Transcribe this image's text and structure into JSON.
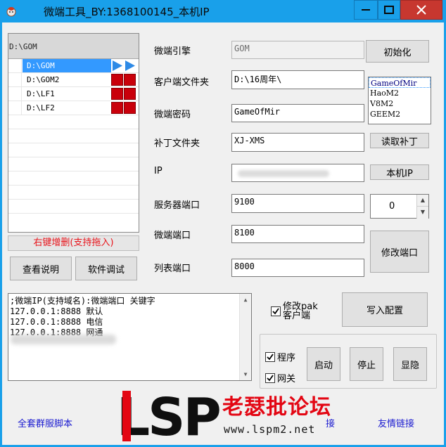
{
  "window": {
    "title": "微端工具_BY:1368100145_本机IP",
    "titlebar_color": "#19a0ea"
  },
  "dir_list": {
    "header": "D:\\GOM",
    "items": [
      {
        "path": "D:\\GOM",
        "selected": true,
        "status_icons": "blue-play-arrows"
      },
      {
        "path": "D:\\GOM2",
        "selected": false,
        "status_icons": "red-squares"
      },
      {
        "path": "D:\\LF1",
        "selected": false,
        "status_icons": "red-squares"
      },
      {
        "path": "D:\\LF2",
        "selected": false,
        "status_icons": "red-squares"
      }
    ],
    "hint": "右键增删(支持拖入)"
  },
  "buttons": {
    "help": "查看说明",
    "debug": "软件调试",
    "init": "初始化",
    "read_patch": "读取补丁",
    "local_ip": "本机IP",
    "modify_port": "修改端口",
    "write_config": "写入配置",
    "start": "启动",
    "stop": "停止",
    "show_hide": "显隐"
  },
  "form": {
    "engine_label": "微端引擎",
    "engine_value": "GOM",
    "client_dir_label": "客户端文件夹",
    "client_dir_value": "D:\\16周年\\",
    "password_label": "微端密码",
    "password_value": "GameOfMir",
    "patch_dir_label": "补丁文件夹",
    "patch_dir_value": "XJ-XMS",
    "ip_label": "IP",
    "ip_value": "",
    "server_port_label": "服务器端口",
    "server_port_value": "9100",
    "micro_port_label": "微端端口",
    "micro_port_value": "8100",
    "list_port_label": "列表端口",
    "list_port_value": "8000"
  },
  "server_types": [
    "GameOfMir",
    "HaoM2",
    "V8M2",
    "GEEM2"
  ],
  "server_type_selected": "GameOfMir",
  "spinner_value": "0",
  "config_memo": {
    "lines": [
      ";微端IP(支持域名):微端端口 关键字",
      "127.0.0.1:8888 默认",
      "127.0.0.1:8888 电信",
      "127.0.0.1:8888 网通"
    ]
  },
  "checkboxes": {
    "modify_pak_line1": "修改pak",
    "modify_pak_line2": "客户端",
    "modify_pak_checked": true,
    "program": "程序",
    "program_checked": true,
    "gateway": "网关",
    "gateway_checked": true
  },
  "footer": {
    "left_link": "全套群服脚本",
    "middle_link_tail": "接",
    "right_link": "友情链接"
  },
  "watermark": {
    "logo_text": "LSP",
    "name": "老瑟批论坛",
    "url": "www.lspm2.net"
  }
}
